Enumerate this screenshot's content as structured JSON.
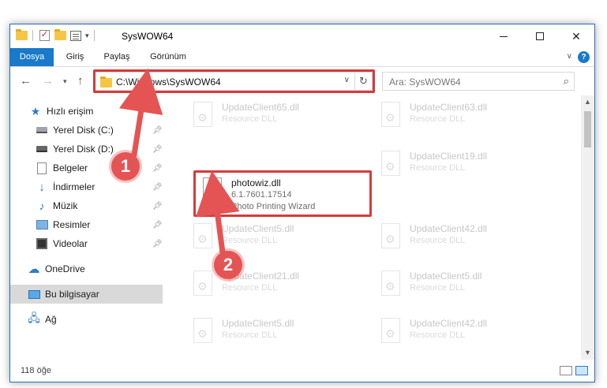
{
  "window": {
    "title": "SysWOW64"
  },
  "ribbon": {
    "tabs": [
      {
        "label": "Dosya"
      },
      {
        "label": "Giriş"
      },
      {
        "label": "Paylaş"
      },
      {
        "label": "Görünüm"
      }
    ],
    "help": "?"
  },
  "address": {
    "path": "C:\\Windows\\SysWOW64"
  },
  "search": {
    "placeholder": "Ara: SysWOW64"
  },
  "nav": {
    "items": [
      {
        "label": "Hızlı erişim",
        "icon": "star-icon"
      },
      {
        "label": "Yerel Disk (C:)",
        "icon": "drive-icon"
      },
      {
        "label": "Yerel Disk (D:)",
        "icon": "drive-icon"
      },
      {
        "label": "Belgeler",
        "icon": "documents-icon"
      },
      {
        "label": "İndirmeler",
        "icon": "downloads-icon"
      },
      {
        "label": "Müzik",
        "icon": "music-icon"
      },
      {
        "label": "Resimler",
        "icon": "pictures-icon"
      },
      {
        "label": "Videolar",
        "icon": "videos-icon"
      },
      {
        "label": "OneDrive",
        "icon": "onedrive-icon"
      },
      {
        "label": "Bu bilgisayar",
        "icon": "this-pc-icon"
      },
      {
        "label": "Ağ",
        "icon": "network-icon"
      }
    ]
  },
  "files": [
    {
      "name": "UpdateClient65.dll",
      "desc": "Resource DLL"
    },
    {
      "name": "UpdateClient63.dll",
      "desc": "Resource DLL"
    },
    {
      "name": "photowiz.dll",
      "version": "6.1.7601.17514",
      "desc": "Photo Printing Wizard"
    },
    {
      "name": "UpdateClient19.dll",
      "desc": "Resource DLL"
    },
    {
      "name": "UpdateClient5.dll",
      "desc": "Resource DLL"
    },
    {
      "name": "UpdateClient42.dll",
      "desc": "Resource DLL"
    },
    {
      "name": "UpdateClient21.dll",
      "desc": "Resource DLL"
    },
    {
      "name": "UpdateClient5.dll",
      "desc": "Resource DLL"
    },
    {
      "name": "UpdateClient5.dll",
      "desc": "Resource DLL"
    },
    {
      "name": "UpdateClient42.dll",
      "desc": "Resource DLL"
    }
  ],
  "status": {
    "count": "118 öğe"
  },
  "callouts": {
    "one": "1",
    "two": "2"
  },
  "colors": {
    "accent": "#1979ca",
    "highlight": "#d33c3c"
  }
}
